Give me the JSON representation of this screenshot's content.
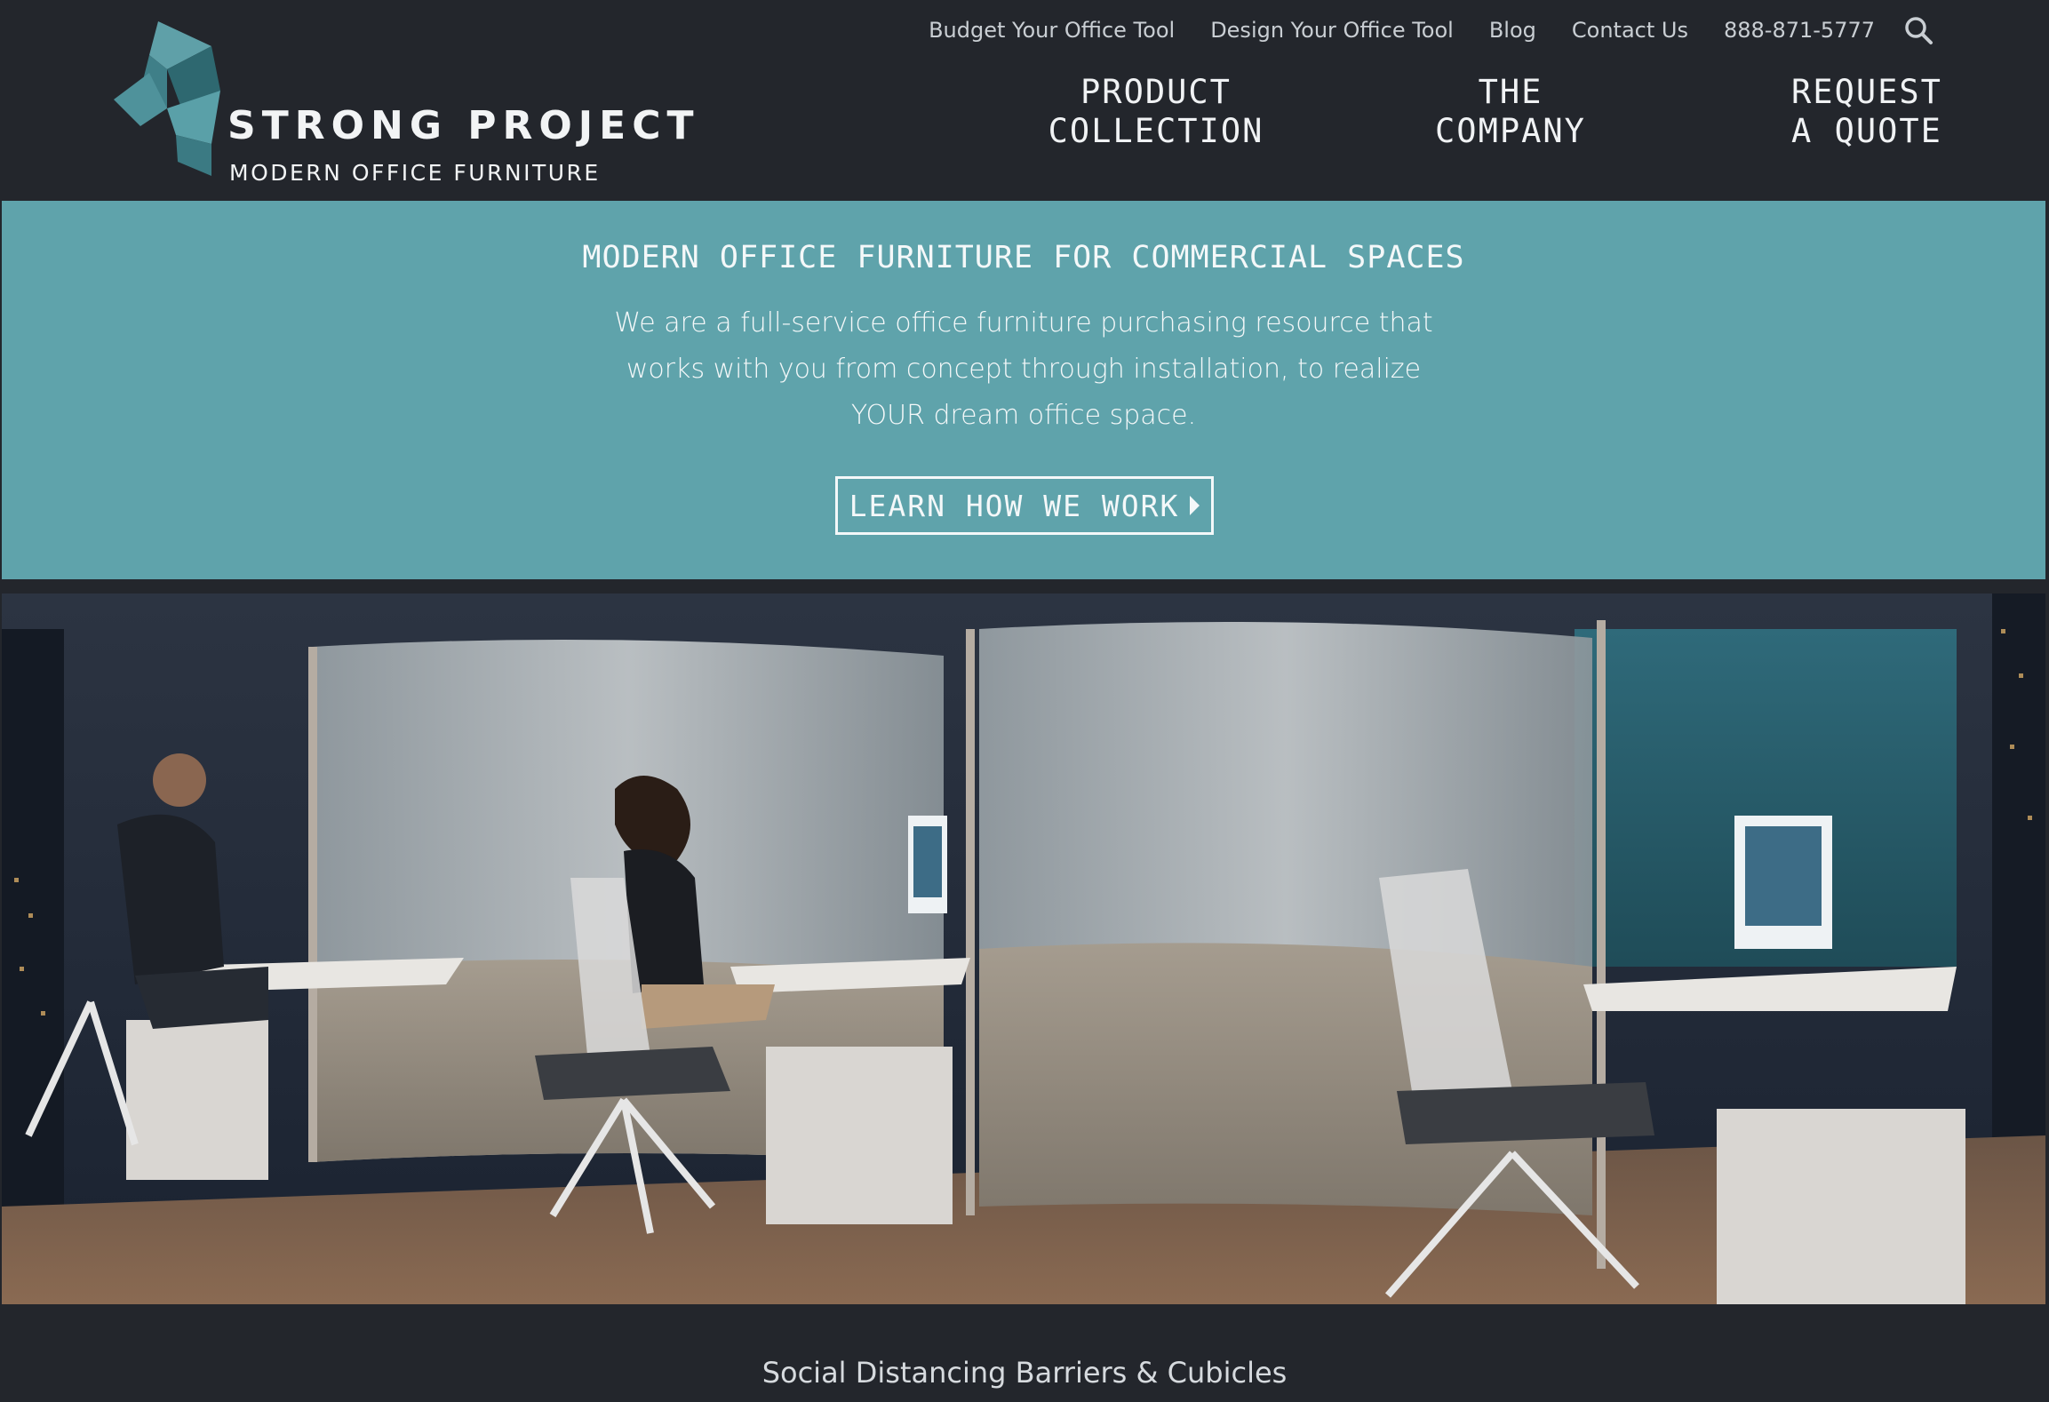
{
  "header": {
    "logo": {
      "brand": "STRONG PROJECT",
      "tagline": "MODERN OFFICE FURNITURE",
      "icon": "cube-logo-icon"
    },
    "utility_nav": [
      {
        "label": "Budget Your Office Tool"
      },
      {
        "label": "Design Your Office Tool"
      },
      {
        "label": "Blog"
      },
      {
        "label": "Contact Us"
      },
      {
        "label": "888-871-5777"
      }
    ],
    "search_icon": "search-icon",
    "main_nav": {
      "product": {
        "line1": "PRODUCT",
        "line2": "COLLECTION"
      },
      "company": {
        "line1": "THE",
        "line2": "COMPANY"
      },
      "quote": {
        "line1": "REQUEST",
        "line2": "A QUOTE"
      }
    }
  },
  "hero": {
    "title": "MODERN OFFICE FURNITURE FOR COMMERCIAL SPACES",
    "text": "We are a full-service office furniture purchasing resource that works with you from concept through installation, to realize YOUR dream office space.",
    "cta_label": "LEARN HOW WE WORK",
    "cta_icon": "caret-right-icon"
  },
  "caption": "Social Distancing Barriers & Cubicles",
  "colors": {
    "background": "#23262c",
    "hero_band": "#5fa3ab",
    "logo_teal": "#4f8c95"
  }
}
